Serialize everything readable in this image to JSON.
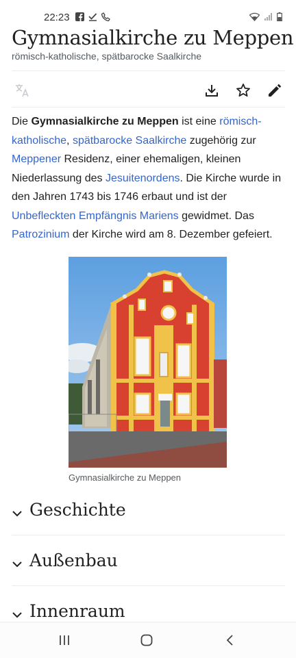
{
  "status_bar": {
    "time": "22:23",
    "left_icons": [
      "facebook-icon",
      "check-icon",
      "phone-icon"
    ],
    "right_icons": [
      "wifi-icon",
      "signal-icon",
      "battery-icon"
    ]
  },
  "article": {
    "title": "Gymnasialkirche zu Meppen",
    "subtitle": "römisch-katholische, spätbarocke Saalkirche"
  },
  "toolbar": {
    "icons": [
      "translate-icon",
      "download-icon",
      "star-icon",
      "edit-icon"
    ]
  },
  "lead": {
    "t1": "Die ",
    "bold": "Gymnasialkirche zu Meppen",
    "t2": " ist eine ",
    "link1": "römisch-katholische",
    "t3": ", ",
    "link2": "spätbarocke Saalkirche",
    "t4": " zugehörig zur ",
    "link3": "Meppener",
    "t5": " Residenz, einer ehemaligen, kleinen Niederlassung des ",
    "link4": "Jesuitenordens",
    "t6": ". Die Kirche wurde in den Jahren 1743 bis 1746 erbaut und ist der ",
    "link5": "Unbefleckten Empfängnis Mariens",
    "t7": " gewidmet. Das ",
    "link6": "Patrozinium",
    "t8": " der Kirche wird am 8. Dezember gefeiert."
  },
  "figure": {
    "caption": "Gymnasialkirche zu Meppen"
  },
  "sections": [
    {
      "title": "Geschichte"
    },
    {
      "title": "Außenbau"
    },
    {
      "title": "Innenraum"
    }
  ],
  "colors": {
    "link": "#3366cc",
    "text": "#202122",
    "muted": "#54595d",
    "church_facade": "#d8402f",
    "church_trim": "#f0c24a"
  },
  "nav_bar": {
    "icons": [
      "recent-apps-icon",
      "home-icon",
      "back-icon"
    ]
  }
}
